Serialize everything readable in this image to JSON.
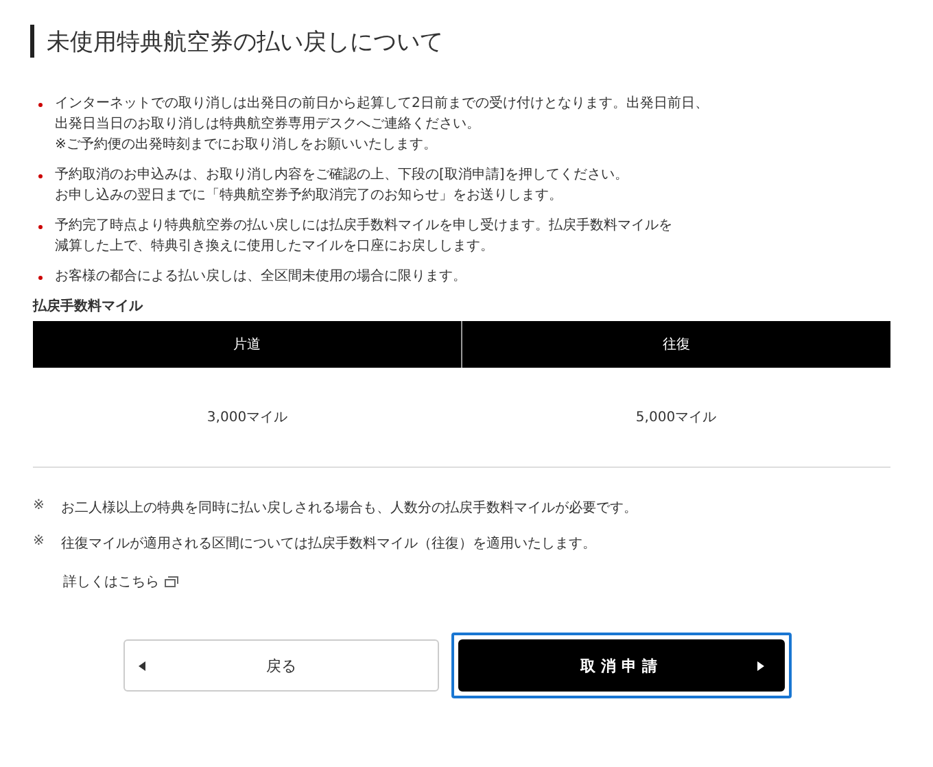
{
  "title": "未使用特典航空券の払い戻しについて",
  "bullets": [
    {
      "lines": [
        "インターネットでの取り消しは出発日の前日から起算して2日前までの受け付けとなります。出発日前日、",
        "出発日当日のお取り消しは特典航空券専用デスクへご連絡ください。",
        "※ご予約便の出発時刻までにお取り消しをお願いいたします。"
      ]
    },
    {
      "lines": [
        "予約取消のお申込みは、お取り消し内容をご確認の上、下段の[取消申請]を押してください。",
        "お申し込みの翌日までに「特典航空券予約取消完了のお知らせ」をお送りします。"
      ]
    },
    {
      "lines": [
        "予約完了時点より特典航空券の払い戻しには払戻手数料マイルを申し受けます。払戻手数料マイルを",
        "減算した上で、特典引き換えに使用したマイルを口座にお戻しします。"
      ]
    },
    {
      "lines": [
        "お客様の都合による払い戻しは、全区間未使用の場合に限ります。"
      ]
    }
  ],
  "fee_table": {
    "caption": "払戻手数料マイル",
    "columns": [
      "片道",
      "往復"
    ],
    "rows": [
      [
        "3,000マイル",
        "5,000マイル"
      ]
    ]
  },
  "notes": [
    {
      "mark": "※",
      "text": "お二人様以上の特典を同時に払い戻しされる場合も、人数分の払戻手数料マイルが必要です。"
    },
    {
      "mark": "※",
      "text": "往復マイルが適用される区間については払戻手数料マイル（往復）を適用いたします。"
    }
  ],
  "link": {
    "label": "詳しくはこちら"
  },
  "buttons": [
    {
      "kind": "back",
      "label": "戻る",
      "focused": false
    },
    {
      "kind": "submit",
      "label": "取消申請",
      "focused": true
    }
  ]
}
